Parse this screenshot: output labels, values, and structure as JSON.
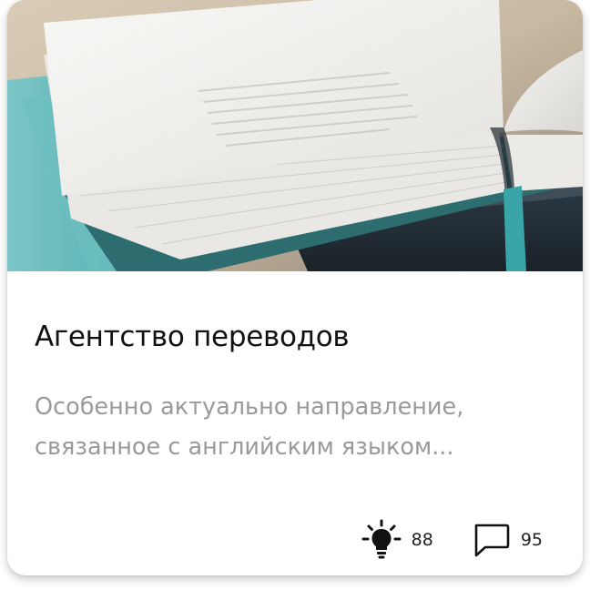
{
  "card": {
    "title": "Агентство переводов",
    "description_lines": [
      "Особенно актуально направление,",
      "связанное с английским языком..."
    ],
    "image_icon": "open-book-photo",
    "stats": {
      "likes": {
        "icon": "lightbulb-icon",
        "count": "88"
      },
      "comments": {
        "icon": "speech-bubble-icon",
        "count": "95"
      }
    }
  },
  "colors": {
    "title": "#111111",
    "description": "#9a9a9a",
    "card_background": "#ffffff",
    "teal_accent": "#3aa5a8"
  }
}
